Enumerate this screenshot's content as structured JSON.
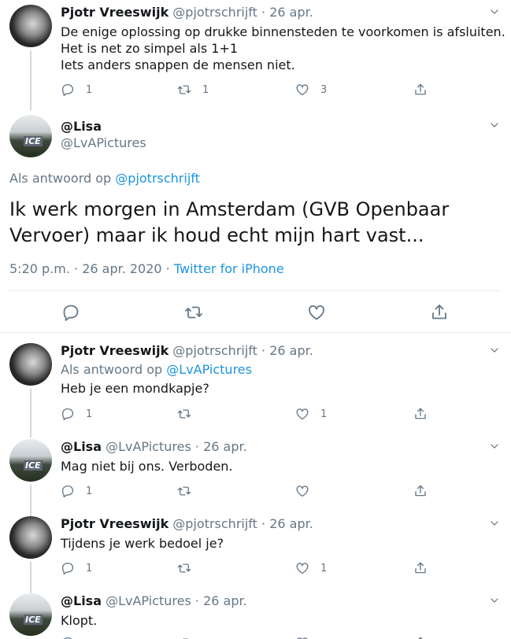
{
  "tweets": [
    {
      "name": "Pjotr Vreeswijk",
      "handle": "@pjotrschrijft",
      "date": "26 apr.",
      "lines": [
        "De enige oplossing op drukke binnensteden te voorkomen is afsluiten.",
        "Het is net zo simpel als 1+1",
        "Iets anders snappen de mensen niet."
      ],
      "replies": "1",
      "retweets": "1",
      "likes": "3"
    }
  ],
  "main_tweet": {
    "name": "@Lisa",
    "handle": "@LvAPictures",
    "reply_prefix": "Als antwoord op",
    "reply_to": "@pjotrschrijft",
    "text": "Ik werk morgen in Amsterdam (GVB Openbaar Vervoer) maar ik houd echt mijn hart vast...",
    "timestamp": "5:20 p.m. · 26 apr. 2020 · ",
    "source": "Twitter for iPhone"
  },
  "replies": [
    {
      "name": "Pjotr Vreeswijk",
      "handle": "@pjotrschrijft",
      "date": "26 apr.",
      "reply_prefix": "Als antwoord op",
      "reply_to": "@LvAPictures",
      "text": "Heb je een mondkapje?",
      "replies": "1",
      "retweets": "",
      "likes": "1"
    },
    {
      "name": "@Lisa",
      "handle": "@LvAPictures",
      "date": "26 apr.",
      "text": "Mag niet bij ons. Verboden.",
      "replies": "1",
      "retweets": "",
      "likes": ""
    },
    {
      "name": "Pjotr Vreeswijk",
      "handle": "@pjotrschrijft",
      "date": "26 apr.",
      "text": "Tijdens je werk bedoel je?",
      "replies": "1",
      "retweets": "",
      "likes": "1"
    },
    {
      "name": "@Lisa",
      "handle": "@LvAPictures",
      "date": "26 apr.",
      "text": "Klopt.",
      "replies": "",
      "retweets": "",
      "likes": ""
    }
  ],
  "avatar_text": "ICE",
  "colors": {
    "text": "#14171a",
    "secondary": "#657786",
    "link": "#1b95e0",
    "divider": "#e6ecf0",
    "thread_line": "#cfd9de"
  },
  "icons": [
    "chevron-down-icon",
    "reply-icon",
    "retweet-icon",
    "like-icon",
    "share-icon"
  ]
}
